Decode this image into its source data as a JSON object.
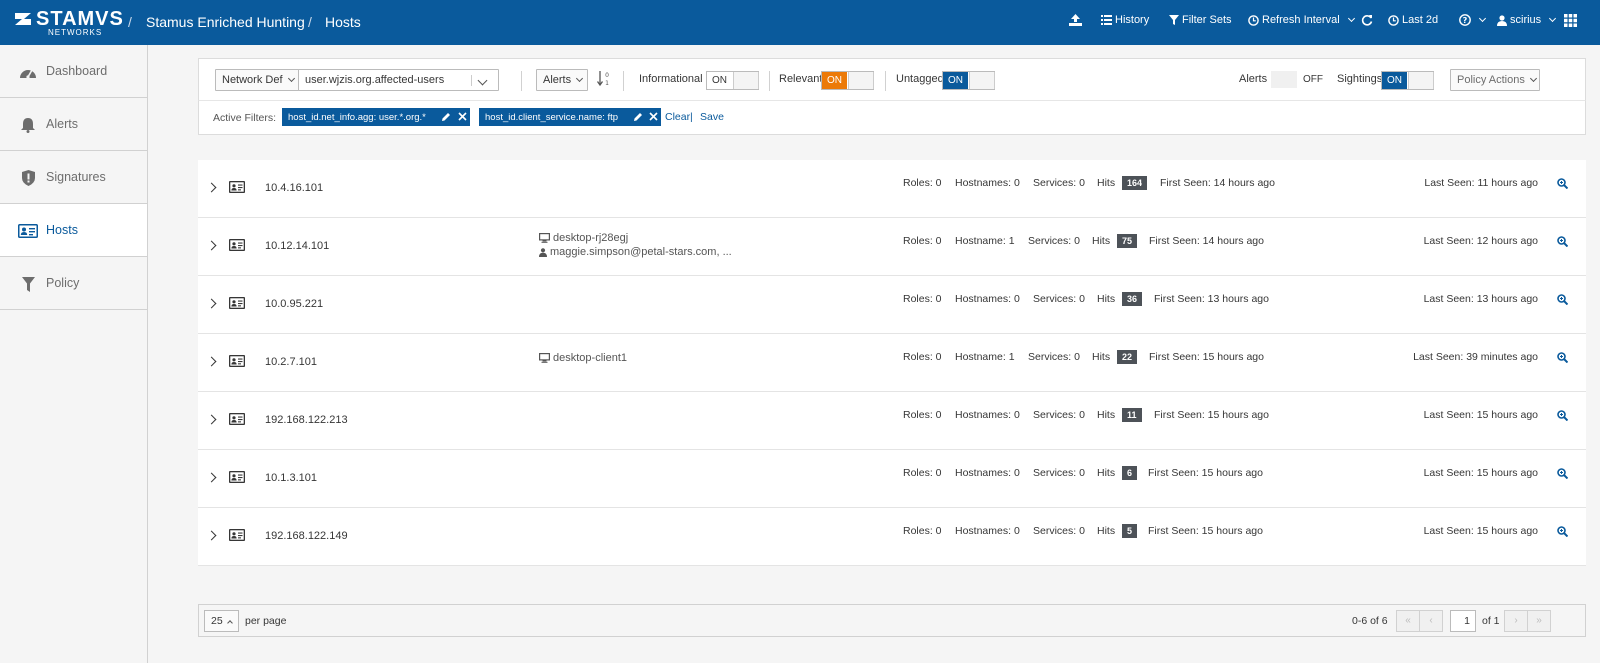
{
  "topbar": {
    "brand": "STAMVS",
    "brand_sub": "NETWORKS",
    "breadcrumb": [
      "Stamus Enriched Hunting",
      "Hosts"
    ],
    "nav": {
      "history": "History",
      "filter_sets": "Filter Sets",
      "refresh_interval": "Refresh Interval",
      "time_range": "Last 2d",
      "user": "scirius"
    }
  },
  "sidebar": {
    "items": [
      {
        "label": "Dashboard",
        "icon": "dashboard-icon"
      },
      {
        "label": "Alerts",
        "icon": "bell-icon"
      },
      {
        "label": "Signatures",
        "icon": "shield-icon"
      },
      {
        "label": "Hosts",
        "icon": "id-card-icon",
        "active": true
      },
      {
        "label": "Policy",
        "icon": "filter-icon"
      }
    ]
  },
  "toolbar": {
    "network_def_label": "Network Def",
    "network_def_value": "user.wjzis.org.affected-users",
    "sort_field": "Alerts",
    "informational_label": "Informational",
    "informational_state": "ON",
    "relevant_label": "Relevant",
    "relevant_state": "ON",
    "untagged_label": "Untagged",
    "untagged_state": "ON",
    "alerts_label": "Alerts",
    "alerts_state": "OFF",
    "sightings_label": "Sightings",
    "sightings_state": "ON",
    "policy_actions": "Policy Actions"
  },
  "filters": {
    "label": "Active Filters:",
    "chips": [
      "host_id.net_info.agg: user.*.org.*",
      "host_id.client_service.name: ftp"
    ],
    "clear": "Clear",
    "save": "Save"
  },
  "hosts": [
    {
      "ip": "10.4.16.101",
      "hostname": "",
      "user": "",
      "roles": "Roles: 0",
      "hostnames": "Hostnames: 0",
      "services": "Services: 0",
      "hits_label": "Hits",
      "hits": "164",
      "first_seen": "First Seen: 14 hours ago",
      "last_seen": "Last Seen: 11 hours ago"
    },
    {
      "ip": "10.12.14.101",
      "hostname": "desktop-rj28egj",
      "user": "maggie.simpson@petal-stars.com, ...",
      "roles": "Roles: 0",
      "hostnames": "Hostname: 1",
      "services": "Services: 0",
      "hits_label": "Hits",
      "hits": "75",
      "first_seen": "First Seen: 14 hours ago",
      "last_seen": "Last Seen: 12 hours ago"
    },
    {
      "ip": "10.0.95.221",
      "hostname": "",
      "user": "",
      "roles": "Roles: 0",
      "hostnames": "Hostnames: 0",
      "services": "Services: 0",
      "hits_label": "Hits",
      "hits": "36",
      "first_seen": "First Seen: 13 hours ago",
      "last_seen": "Last Seen: 13 hours ago"
    },
    {
      "ip": "10.2.7.101",
      "hostname": "desktop-client1",
      "user": "",
      "roles": "Roles: 0",
      "hostnames": "Hostname: 1",
      "services": "Services: 0",
      "hits_label": "Hits",
      "hits": "22",
      "first_seen": "First Seen: 15 hours ago",
      "last_seen": "Last Seen: 39 minutes ago"
    },
    {
      "ip": "192.168.122.213",
      "hostname": "",
      "user": "",
      "roles": "Roles: 0",
      "hostnames": "Hostnames: 0",
      "services": "Services: 0",
      "hits_label": "Hits",
      "hits": "11",
      "first_seen": "First Seen: 15 hours ago",
      "last_seen": "Last Seen: 15 hours ago"
    },
    {
      "ip": "10.1.3.101",
      "hostname": "",
      "user": "",
      "roles": "Roles: 0",
      "hostnames": "Hostnames: 0",
      "services": "Services: 0",
      "hits_label": "Hits",
      "hits": "6",
      "first_seen": "First Seen: 15 hours ago",
      "last_seen": "Last Seen: 15 hours ago"
    },
    {
      "ip": "192.168.122.149",
      "hostname": "",
      "user": "",
      "roles": "Roles: 0",
      "hostnames": "Hostnames: 0",
      "services": "Services: 0",
      "hits_label": "Hits",
      "hits": "5",
      "first_seen": "First Seen: 15 hours ago",
      "last_seen": "Last Seen: 15 hours ago"
    }
  ],
  "pagination": {
    "per_page": "25",
    "per_page_label": "per page",
    "range": "0-6 of 6",
    "page": "1",
    "of_pages": "of 1"
  },
  "colors": {
    "brand_blue": "#0a5a9c",
    "orange": "#ec7a08",
    "badge_gray": "#4d5258"
  }
}
